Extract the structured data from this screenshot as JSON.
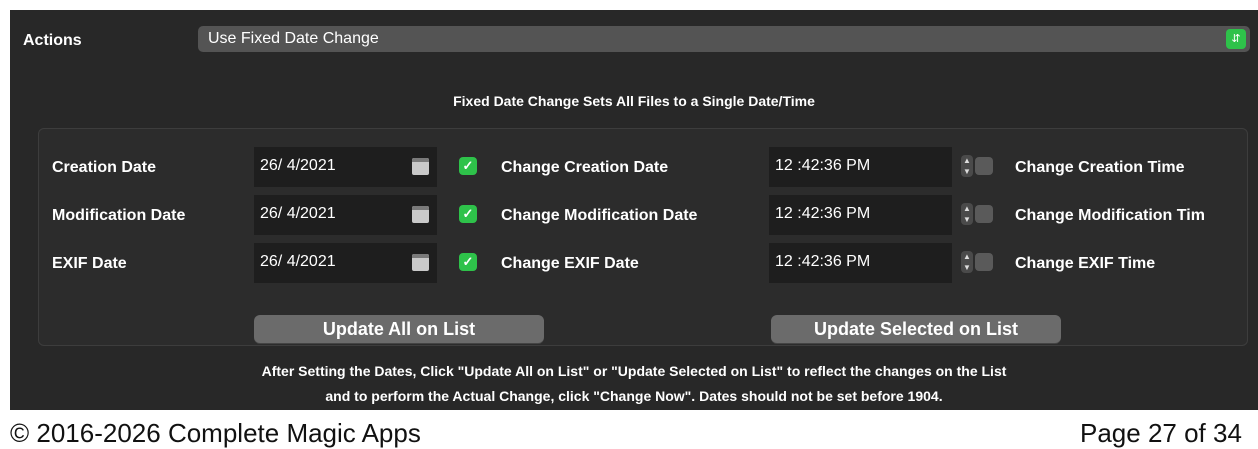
{
  "actions": {
    "label": "Actions",
    "selected": "Use Fixed Date Change"
  },
  "subtitle": "Fixed Date Change Sets All Files to a Single Date/Time",
  "rows": [
    {
      "label": "Creation Date",
      "date": "26/ 4/2021",
      "date_checked": true,
      "date_check_label": "Change Creation Date",
      "time": "12 :42:36 PM",
      "time_checked": false,
      "time_check_label": "Change Creation Time"
    },
    {
      "label": "Modification Date",
      "date": "26/ 4/2021",
      "date_checked": true,
      "date_check_label": "Change Modification Date",
      "time": "12 :42:36 PM",
      "time_checked": false,
      "time_check_label": "Change Modification Tim"
    },
    {
      "label": "EXIF Date",
      "date": "26/ 4/2021",
      "date_checked": true,
      "date_check_label": "Change EXIF Date",
      "time": "12 :42:36 PM",
      "time_checked": false,
      "time_check_label": "Change EXIF Time"
    }
  ],
  "buttons": {
    "update_all": "Update All on List",
    "update_selected": "Update Selected on List"
  },
  "footnote": {
    "line1": "After Setting the Dates, Click \"Update All on List\" or \"Update Selected on List\" to reflect the changes on the List",
    "line2": "and to perform the Actual Change, click \"Change Now\". Dates should not be set before 1904."
  },
  "page_footer": {
    "copyright": "© 2016-2026 Complete Magic Apps",
    "page": "Page 27 of 34"
  },
  "colors": {
    "accent": "#2ec24a",
    "panel": "#282828"
  }
}
